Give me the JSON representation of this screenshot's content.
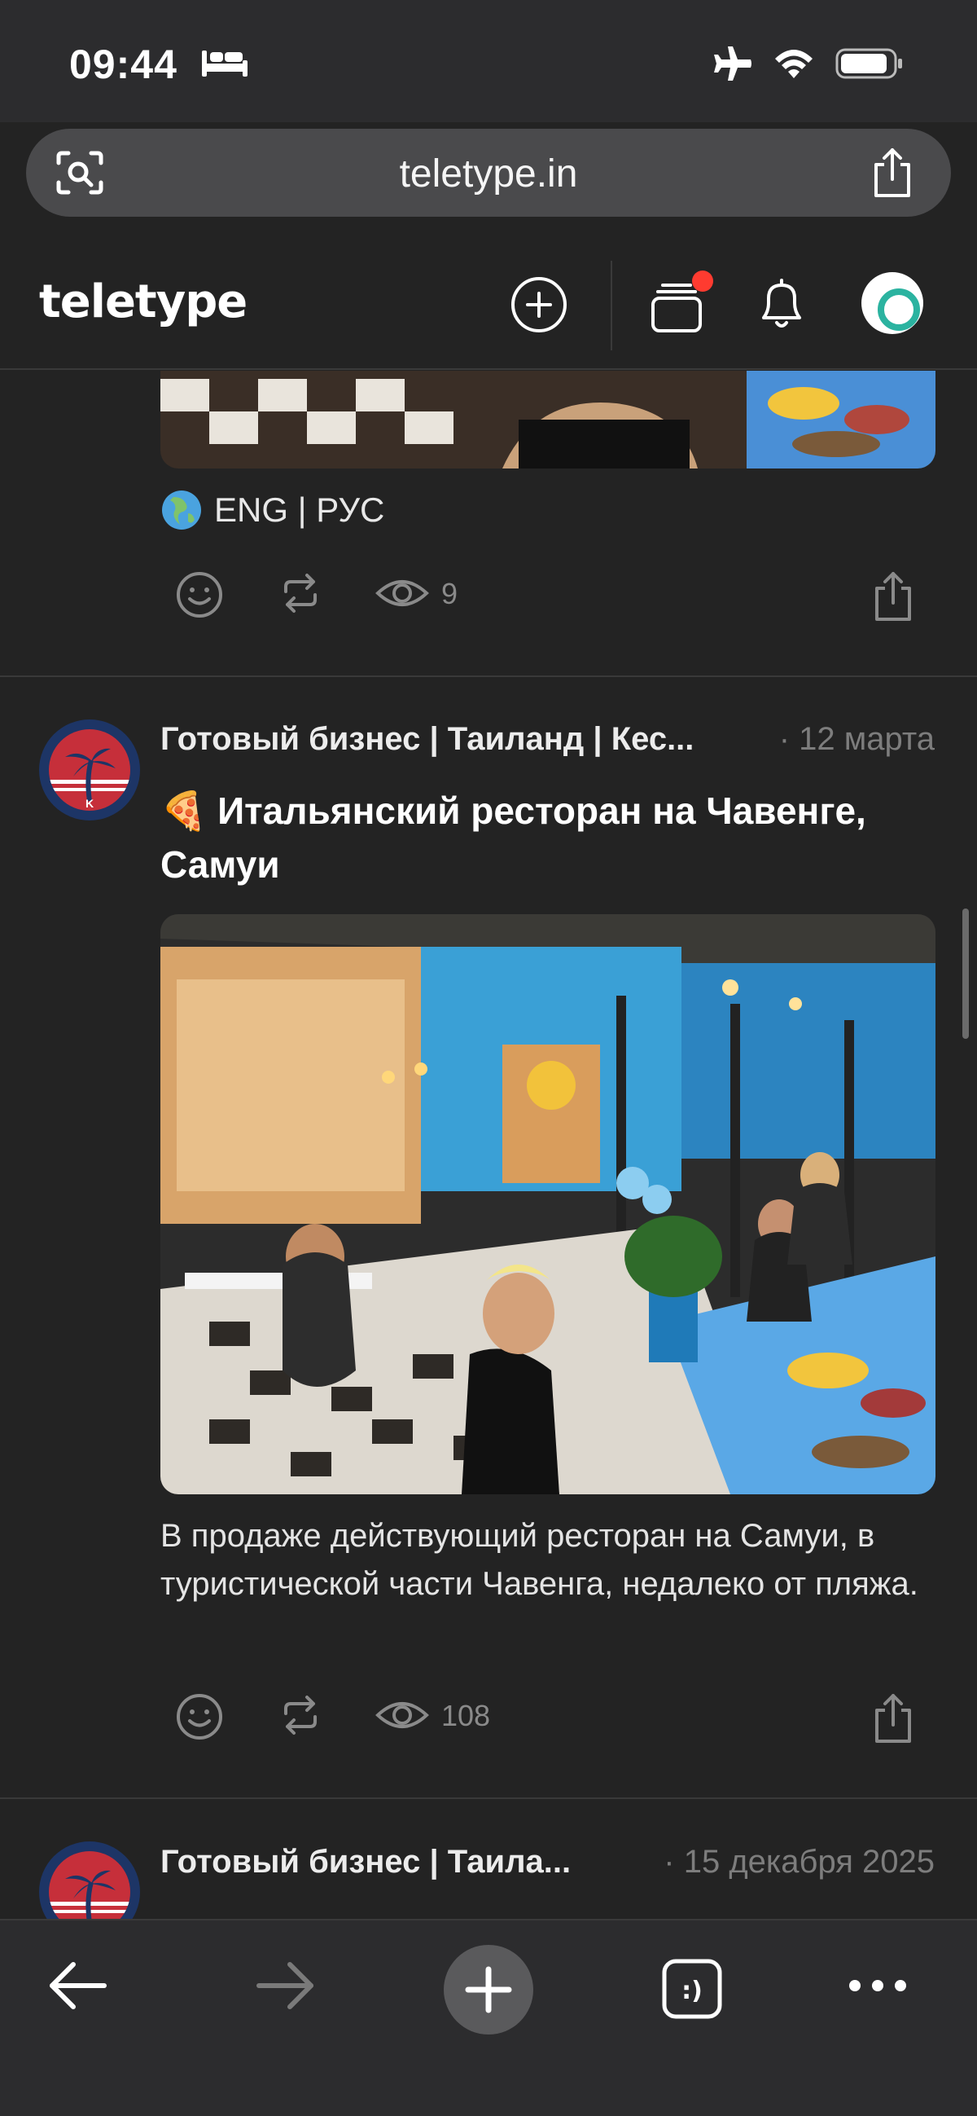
{
  "status_bar": {
    "time": "09:44"
  },
  "browser": {
    "url": "teletype.in"
  },
  "header": {
    "logo": "teletype"
  },
  "post_prev": {
    "languages": "ENG | РУС",
    "views": "9"
  },
  "post_main": {
    "author": "Готовый бизнес | Таиланд | Кес...",
    "date": "· 12 марта",
    "title_emoji": "🍕",
    "title": "Итальянский ресторан на Чавенге, Самуи",
    "excerpt": "В продаже действующий ресторан на Самуи, в туристической части Чавенга, недалеко от пляжа.",
    "views": "108"
  },
  "post_next": {
    "author": "Готовый бизнес | Таила...",
    "date": "· 15 декабря 2025"
  },
  "colors": {
    "background": "#232323",
    "chrome": "#2c2c2e",
    "notification": "#ff3b30"
  }
}
